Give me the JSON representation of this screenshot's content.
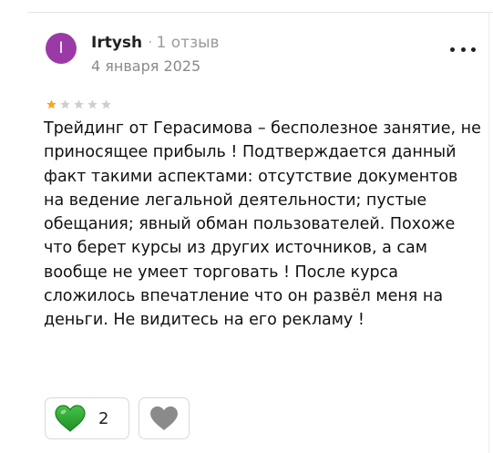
{
  "review": {
    "author": {
      "initial": "I",
      "name": "Irtysh",
      "separator": "·",
      "reviews_count": "1 отзыв",
      "avatar_color": "#9b3aa6"
    },
    "date": "4 января 2025",
    "rating": {
      "value": 1,
      "max": 5,
      "filled_color": "#f5a623",
      "empty_color": "#cfcfcf"
    },
    "text": "Трейдинг от Герасимова – бесполезное занятие, не приносящее прибыль ! Подтверждается данный факт такими аспектами: отсутствие документов на ведение легальной деятельности; пустые обещания; явный обман пользователей. Похоже что берет курсы из других источников, а сам вообще не умеет торговать ! После курса сложилось впечатление что он развёл меня на деньги. Не видитесь на его рекламу !",
    "actions": {
      "like": {
        "icon": "green-heart-icon",
        "count": "2",
        "color": "#2fa62f"
      },
      "dislike": {
        "icon": "gray-heart-icon",
        "color": "#8a8a8a"
      }
    },
    "menu_icon": "more-dots-icon"
  }
}
